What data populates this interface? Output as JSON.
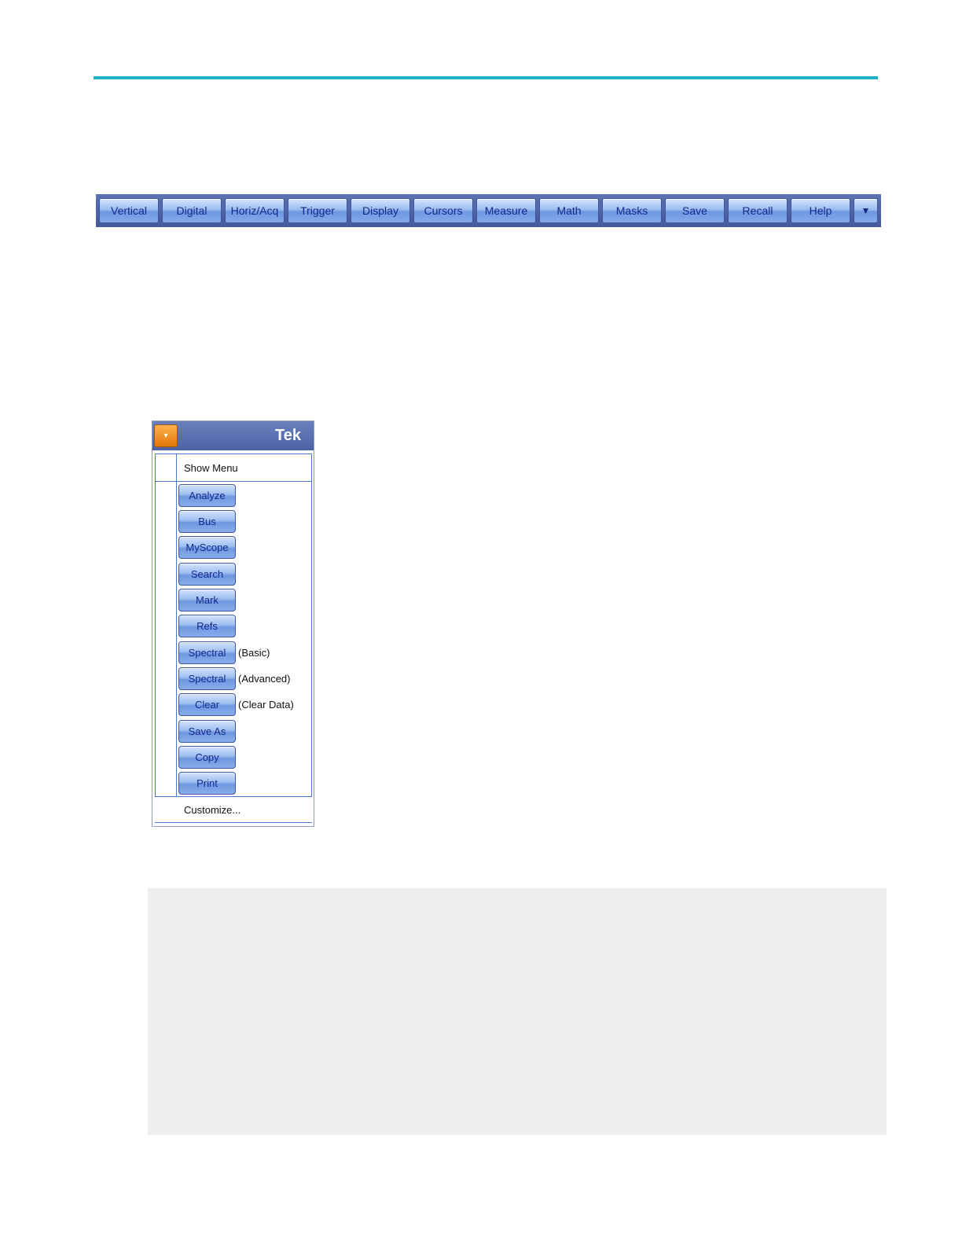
{
  "menubar": {
    "items": [
      "Vertical",
      "Digital",
      "Horiz/Acq",
      "Trigger",
      "Display",
      "Cursors",
      "Measure",
      "Math",
      "Masks",
      "Save",
      "Recall",
      "Help"
    ],
    "overflow_glyph": "▼"
  },
  "panel": {
    "toggle_glyph": "▾",
    "brand": "Tek",
    "show_menu": "Show Menu",
    "items": [
      {
        "label": "Analyze",
        "note": ""
      },
      {
        "label": "Bus",
        "note": ""
      },
      {
        "label": "MyScope",
        "note": ""
      },
      {
        "label": "Search",
        "note": ""
      },
      {
        "label": "Mark",
        "note": ""
      },
      {
        "label": "Refs",
        "note": ""
      },
      {
        "label": "Spectral",
        "note": "(Basic)"
      },
      {
        "label": "Spectral",
        "note": "(Advanced)"
      },
      {
        "label": "Clear",
        "note": "(Clear Data)"
      },
      {
        "label": "Save As",
        "note": ""
      },
      {
        "label": "Copy",
        "note": ""
      },
      {
        "label": "Print",
        "note": ""
      }
    ],
    "customize": "Customize..."
  },
  "colors": {
    "rule": "#1fb1cc",
    "menubar_bg": "#4d62a4",
    "button_text": "#13288a",
    "orange_button": "#f08a1c",
    "gray_box": "#efefef"
  }
}
